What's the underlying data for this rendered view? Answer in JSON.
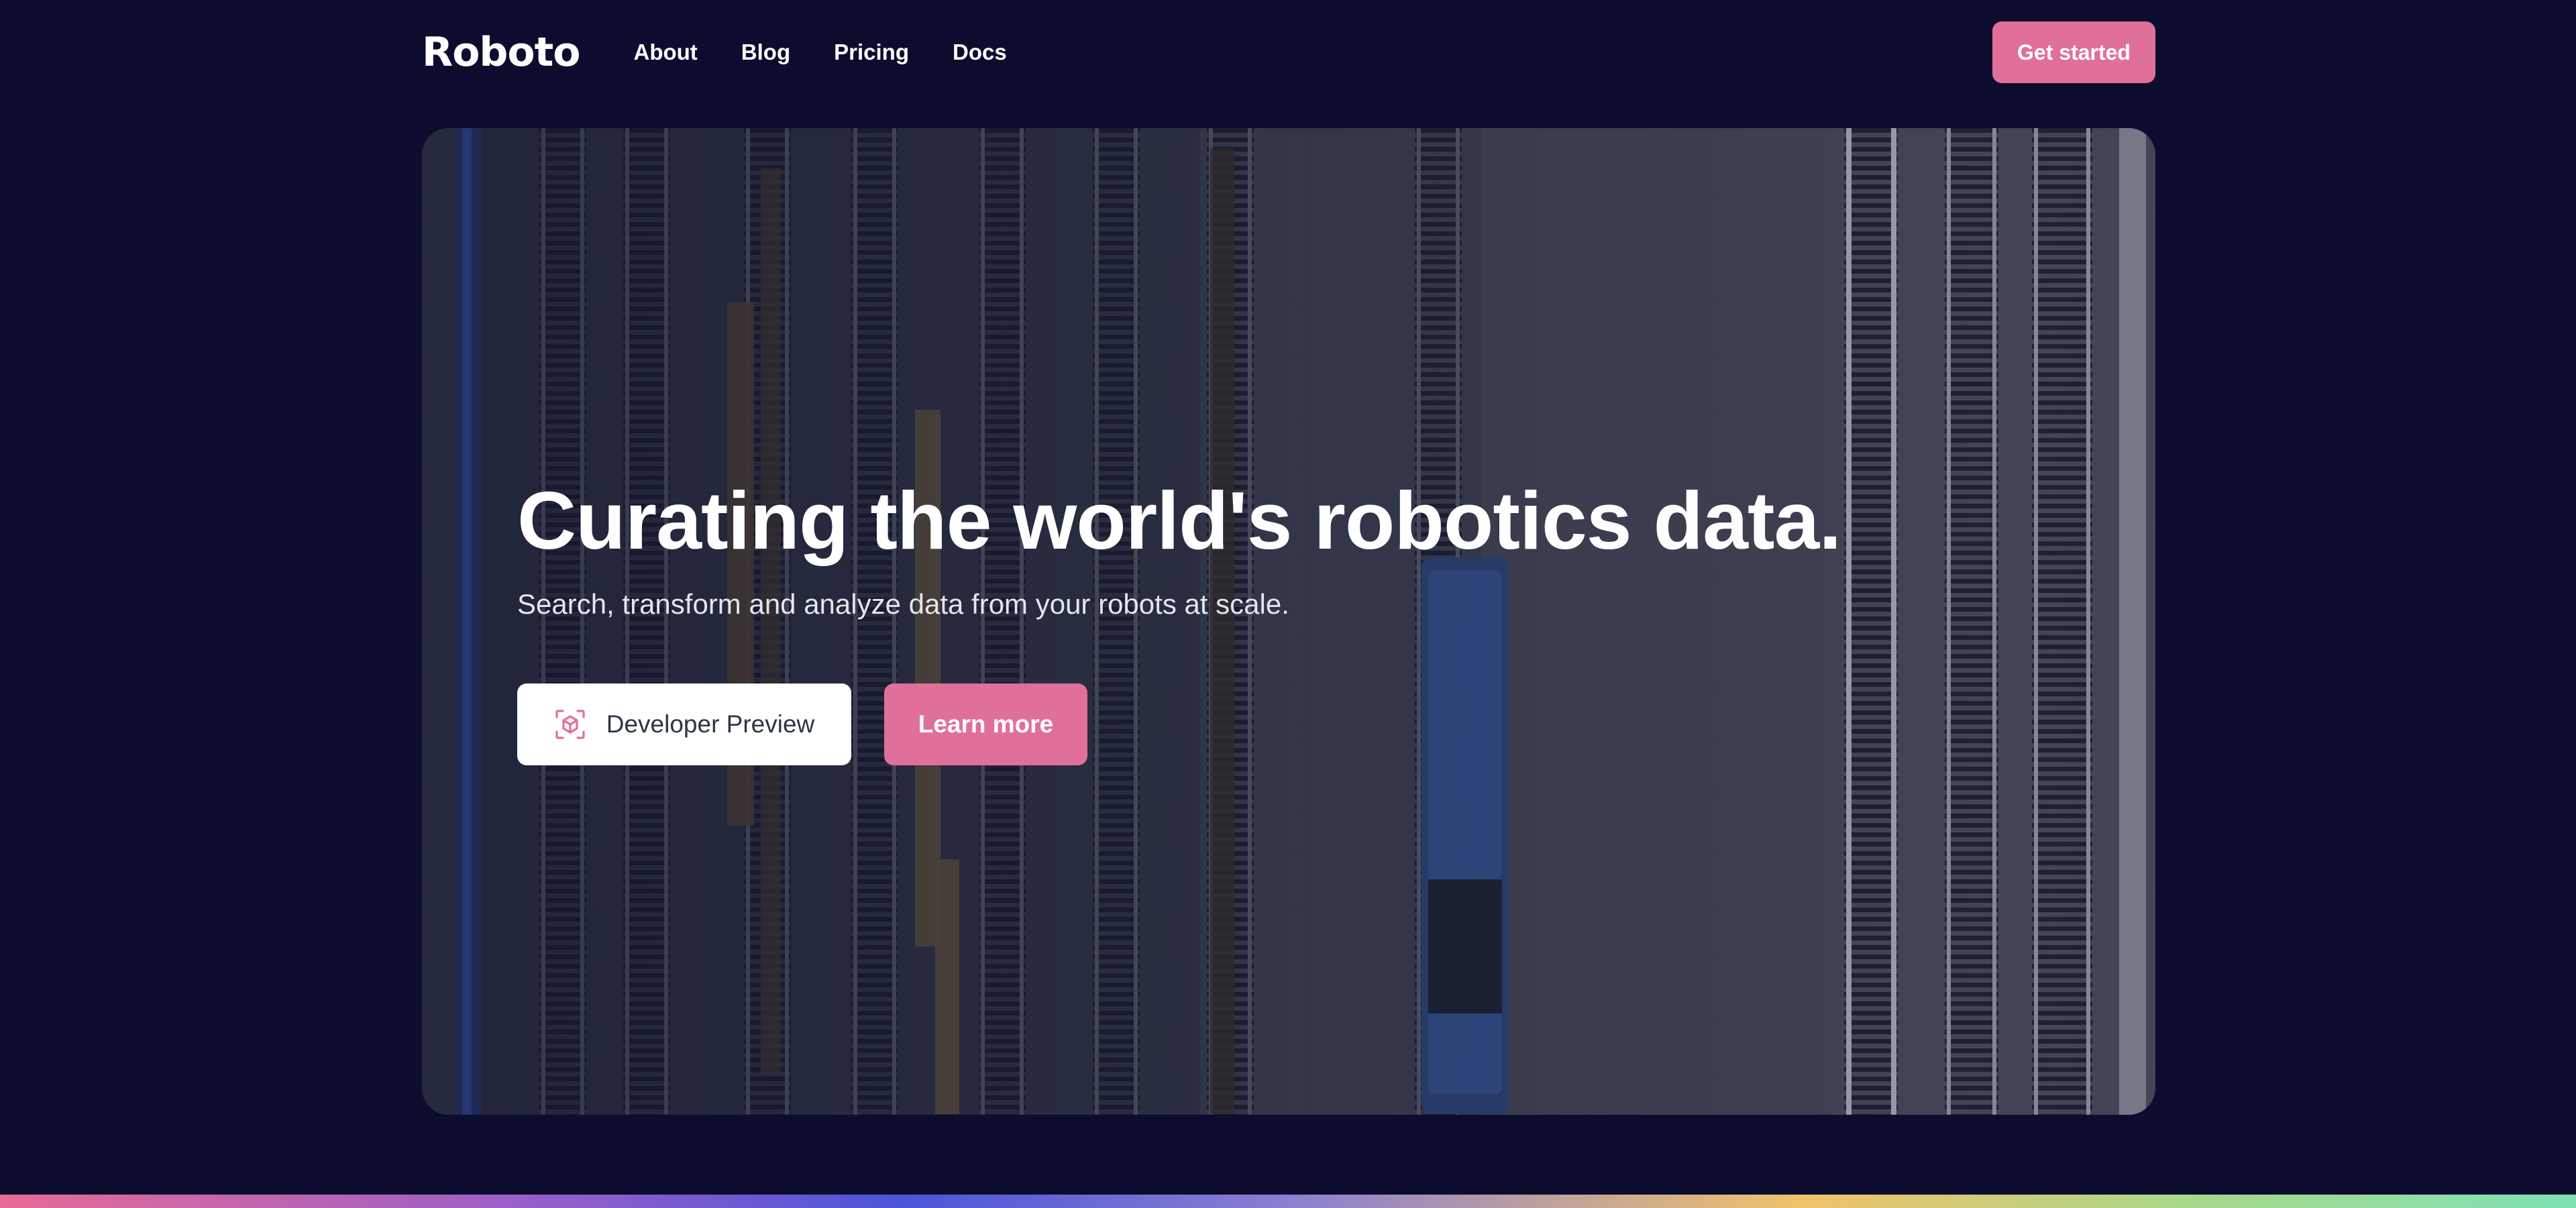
{
  "header": {
    "logo_text": "Roboto",
    "nav": [
      {
        "label": "About"
      },
      {
        "label": "Blog"
      },
      {
        "label": "Pricing"
      },
      {
        "label": "Docs"
      }
    ],
    "cta_label": "Get started"
  },
  "hero": {
    "headline": "Curating the world's robotics data.",
    "subtitle": "Search, transform and analyze data from your robots at scale.",
    "primary_button": {
      "label": "Developer Preview",
      "icon": "cube-focus-icon"
    },
    "secondary_button": {
      "label": "Learn more"
    },
    "background": "aerial rail yard photo"
  },
  "colors": {
    "page_background": "#0c0d2e",
    "accent_pink": "#e0709a",
    "white": "#ffffff"
  }
}
